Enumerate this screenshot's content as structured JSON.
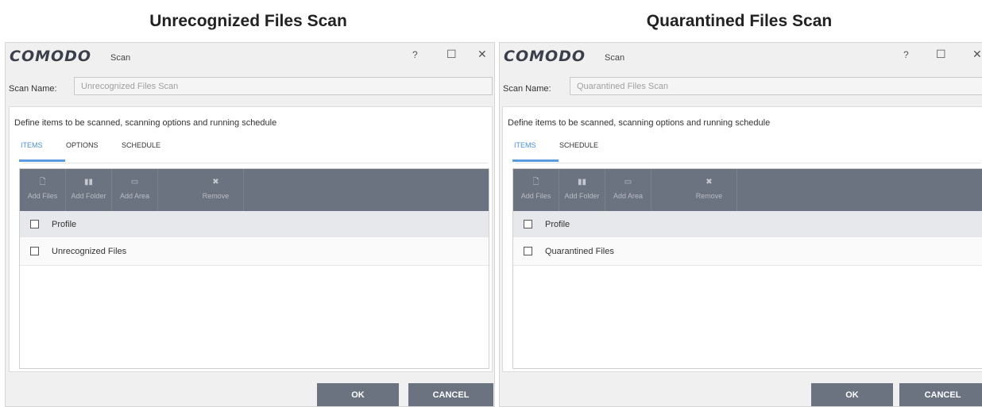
{
  "captions": {
    "left": "Unrecognized Files Scan",
    "right": "Quarantined Files Scan"
  },
  "windows": [
    {
      "logo": "COMODO",
      "title": "Scan",
      "controls": {
        "help": "?",
        "maximize": "☐",
        "close": "✕"
      },
      "scan_name_label": "Scan Name:",
      "scan_name_value": "Unrecognized Files Scan",
      "description": "Define items to be scanned, scanning options and running schedule",
      "tabs": [
        "ITEMS",
        "OPTIONS",
        "SCHEDULE"
      ],
      "active_tab": "ITEMS",
      "toolbar": [
        {
          "icon": "add-files-icon",
          "glyph": "🗋",
          "label": "Add Files"
        },
        {
          "icon": "add-folder-icon",
          "glyph": "▮▮",
          "label": "Add Folder"
        },
        {
          "icon": "add-area-icon",
          "glyph": "▭",
          "label": "Add Area"
        },
        {
          "icon": "remove-icon",
          "glyph": "✖",
          "label": "Remove"
        }
      ],
      "column_header": "Profile",
      "rows": [
        "Unrecognized Files"
      ],
      "buttons": {
        "ok": "OK",
        "cancel": "CANCEL"
      }
    },
    {
      "logo": "COMODO",
      "title": "Scan",
      "controls": {
        "help": "?",
        "maximize": "☐",
        "close": "✕"
      },
      "scan_name_label": "Scan Name:",
      "scan_name_value": "Quarantined Files Scan",
      "description": "Define items to be scanned, scanning options and running schedule",
      "tabs": [
        "ITEMS",
        "SCHEDULE"
      ],
      "active_tab": "ITEMS",
      "toolbar": [
        {
          "icon": "add-files-icon",
          "glyph": "🗋",
          "label": "Add Files"
        },
        {
          "icon": "add-folder-icon",
          "glyph": "▮▮",
          "label": "Add Folder"
        },
        {
          "icon": "add-area-icon",
          "glyph": "▭",
          "label": "Add Area"
        },
        {
          "icon": "remove-icon",
          "glyph": "✖",
          "label": "Remove"
        }
      ],
      "column_header": "Profile",
      "rows": [
        "Quarantined Files"
      ],
      "buttons": {
        "ok": "OK",
        "cancel": "CANCEL"
      }
    }
  ],
  "colors": {
    "toolbar_bg": "#6b7280",
    "tab_active": "#4a8fd6",
    "button_bg": "#6b7280",
    "header_row_bg": "#e6e8ec"
  }
}
